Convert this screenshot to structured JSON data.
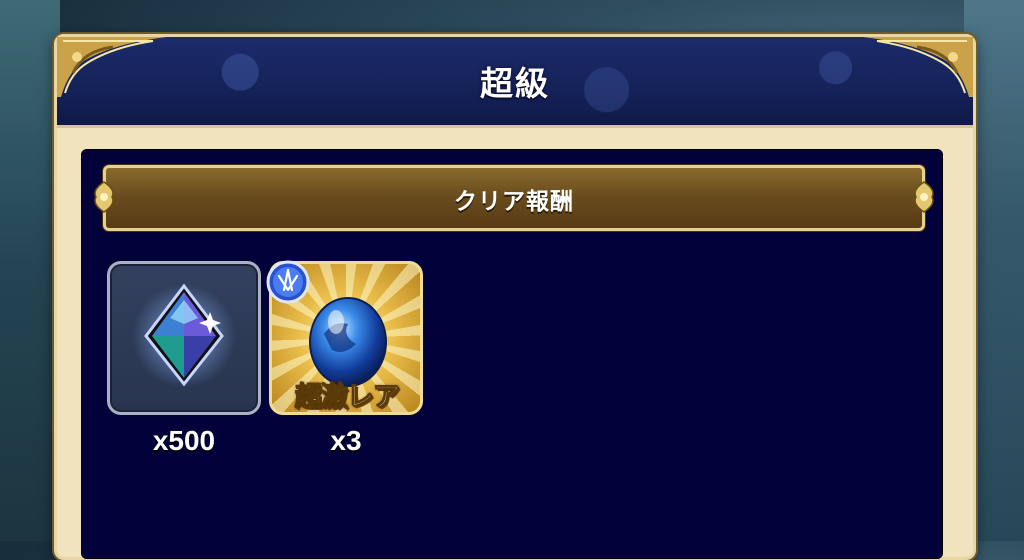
{
  "dialog": {
    "title": "超級"
  },
  "rewards_section": {
    "header": "クリア報酬",
    "items": [
      {
        "icon": "crystal-icon",
        "quantity": "x500"
      },
      {
        "icon": "egg-icon",
        "badge_icon": "wing-badge-icon",
        "rarity_label": "超激レア",
        "quantity": "x3"
      }
    ]
  },
  "colors": {
    "header_bg": "#152259",
    "panel_border": "#e8d7a6",
    "inner_bg": "#02013a",
    "banner_bg": "#6a4d1e",
    "egg_tile_gold": "#e9bd4a"
  }
}
